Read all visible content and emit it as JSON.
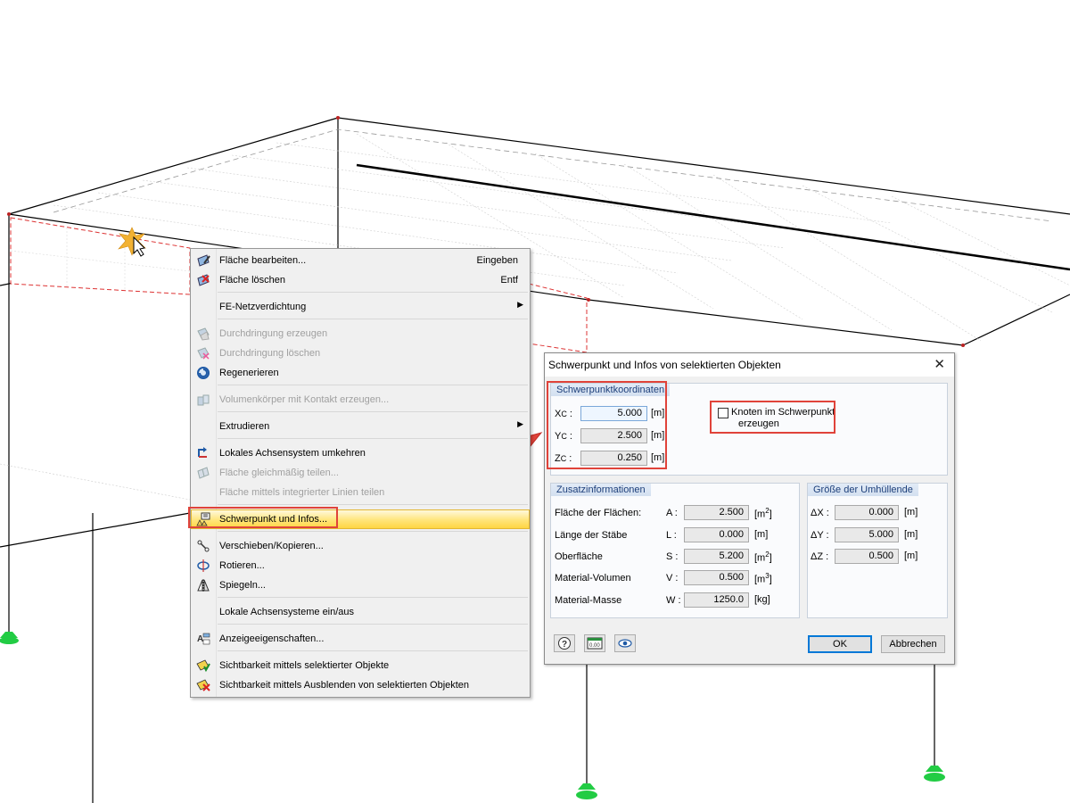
{
  "context_menu": {
    "items": [
      {
        "label": "Fläche bearbeiten...",
        "shortcut": "Eingeben",
        "enabled": true,
        "icon": "edit-surface-icon"
      },
      {
        "label": "Fläche löschen",
        "shortcut": "Entf",
        "enabled": true,
        "icon": "delete-surface-icon"
      },
      {
        "label": "FE-Netzverdichtung",
        "submenu": true,
        "enabled": true
      },
      {
        "label": "Durchdringung erzeugen",
        "enabled": false,
        "icon": "create-intersection-icon"
      },
      {
        "label": "Durchdringung löschen",
        "enabled": false,
        "icon": "delete-intersection-icon"
      },
      {
        "label": "Regenerieren",
        "enabled": true,
        "icon": "regenerate-icon"
      },
      {
        "label": "Volumenkörper mit Kontakt erzeugen...",
        "enabled": false,
        "icon": "solid-contact-icon"
      },
      {
        "label": "Extrudieren",
        "submenu": true,
        "enabled": true
      },
      {
        "label": "Lokales Achsensystem umkehren",
        "enabled": true,
        "icon": "reverse-axis-icon"
      },
      {
        "label": "Fläche gleichmäßig teilen...",
        "enabled": false,
        "icon": "divide-surface-icon"
      },
      {
        "label": "Fläche mittels integrierter Linien teilen",
        "enabled": false
      },
      {
        "label": "Schwerpunkt und Infos...",
        "enabled": true,
        "highlighted": true,
        "icon": "centroid-info-icon"
      },
      {
        "label": "Verschieben/Kopieren...",
        "enabled": true,
        "icon": "move-copy-icon"
      },
      {
        "label": "Rotieren...",
        "enabled": true,
        "icon": "rotate-icon"
      },
      {
        "label": "Spiegeln...",
        "enabled": true,
        "icon": "mirror-icon"
      },
      {
        "label": "Lokale Achsensysteme ein/aus",
        "enabled": true
      },
      {
        "label": "Anzeigeeigenschaften...",
        "enabled": true,
        "icon": "display-properties-icon"
      },
      {
        "label": "Sichtbarkeit mittels selektierter Objekte",
        "enabled": true,
        "icon": "visibility-selected-icon"
      },
      {
        "label": "Sichtbarkeit mittels Ausblenden von selektierten Objekten",
        "enabled": true,
        "icon": "visibility-hide-icon"
      }
    ]
  },
  "dialog": {
    "title": "Schwerpunkt und Infos von selektierten Objekten",
    "centroid": {
      "header": "Schwerpunktkoordinaten",
      "rows": [
        {
          "label": "X",
          "sub": "C",
          "value": "5.000",
          "unit": "[m]"
        },
        {
          "label": "Y",
          "sub": "C",
          "value": "2.500",
          "unit": "[m]"
        },
        {
          "label": "Z",
          "sub": "C",
          "value": "0.250",
          "unit": "[m]"
        }
      ],
      "checkbox_label_1": "Knoten im Schwerpunkt",
      "checkbox_label_2": "erzeugen",
      "checkbox_checked": false
    },
    "additional": {
      "header": "Zusatzinformationen",
      "rows": [
        {
          "label": "Fläche der Flächen:",
          "symbol": "A :",
          "value": "2.500",
          "unit": "[m",
          "unit_exp": "2",
          "unit_end": "]"
        },
        {
          "label": "Länge der Stäbe",
          "symbol": "L :",
          "value": "0.000",
          "unit": "[m]"
        },
        {
          "label": "Oberfläche",
          "symbol": "S :",
          "value": "5.200",
          "unit": "[m",
          "unit_exp": "2",
          "unit_end": "]"
        },
        {
          "label": "Material-Volumen",
          "symbol": "V :",
          "value": "0.500",
          "unit": "[m",
          "unit_exp": "3",
          "unit_end": "]"
        },
        {
          "label": "Material-Masse",
          "symbol": "W :",
          "value": "1250.0",
          "unit": "[kg]"
        }
      ]
    },
    "envelope": {
      "header": "Größe der Umhüllende",
      "rows": [
        {
          "label": "ΔX :",
          "value": "0.000",
          "unit": "[m]"
        },
        {
          "label": "ΔY :",
          "value": "5.000",
          "unit": "[m]"
        },
        {
          "label": "ΔZ :",
          "value": "0.500",
          "unit": "[m]"
        }
      ]
    },
    "ok_label": "OK",
    "cancel_label": "Abbrechen"
  },
  "colors": {
    "highlight_box": "#e0433a",
    "support_green": "#22cc44",
    "group_header_text": "#1d3f7a"
  }
}
